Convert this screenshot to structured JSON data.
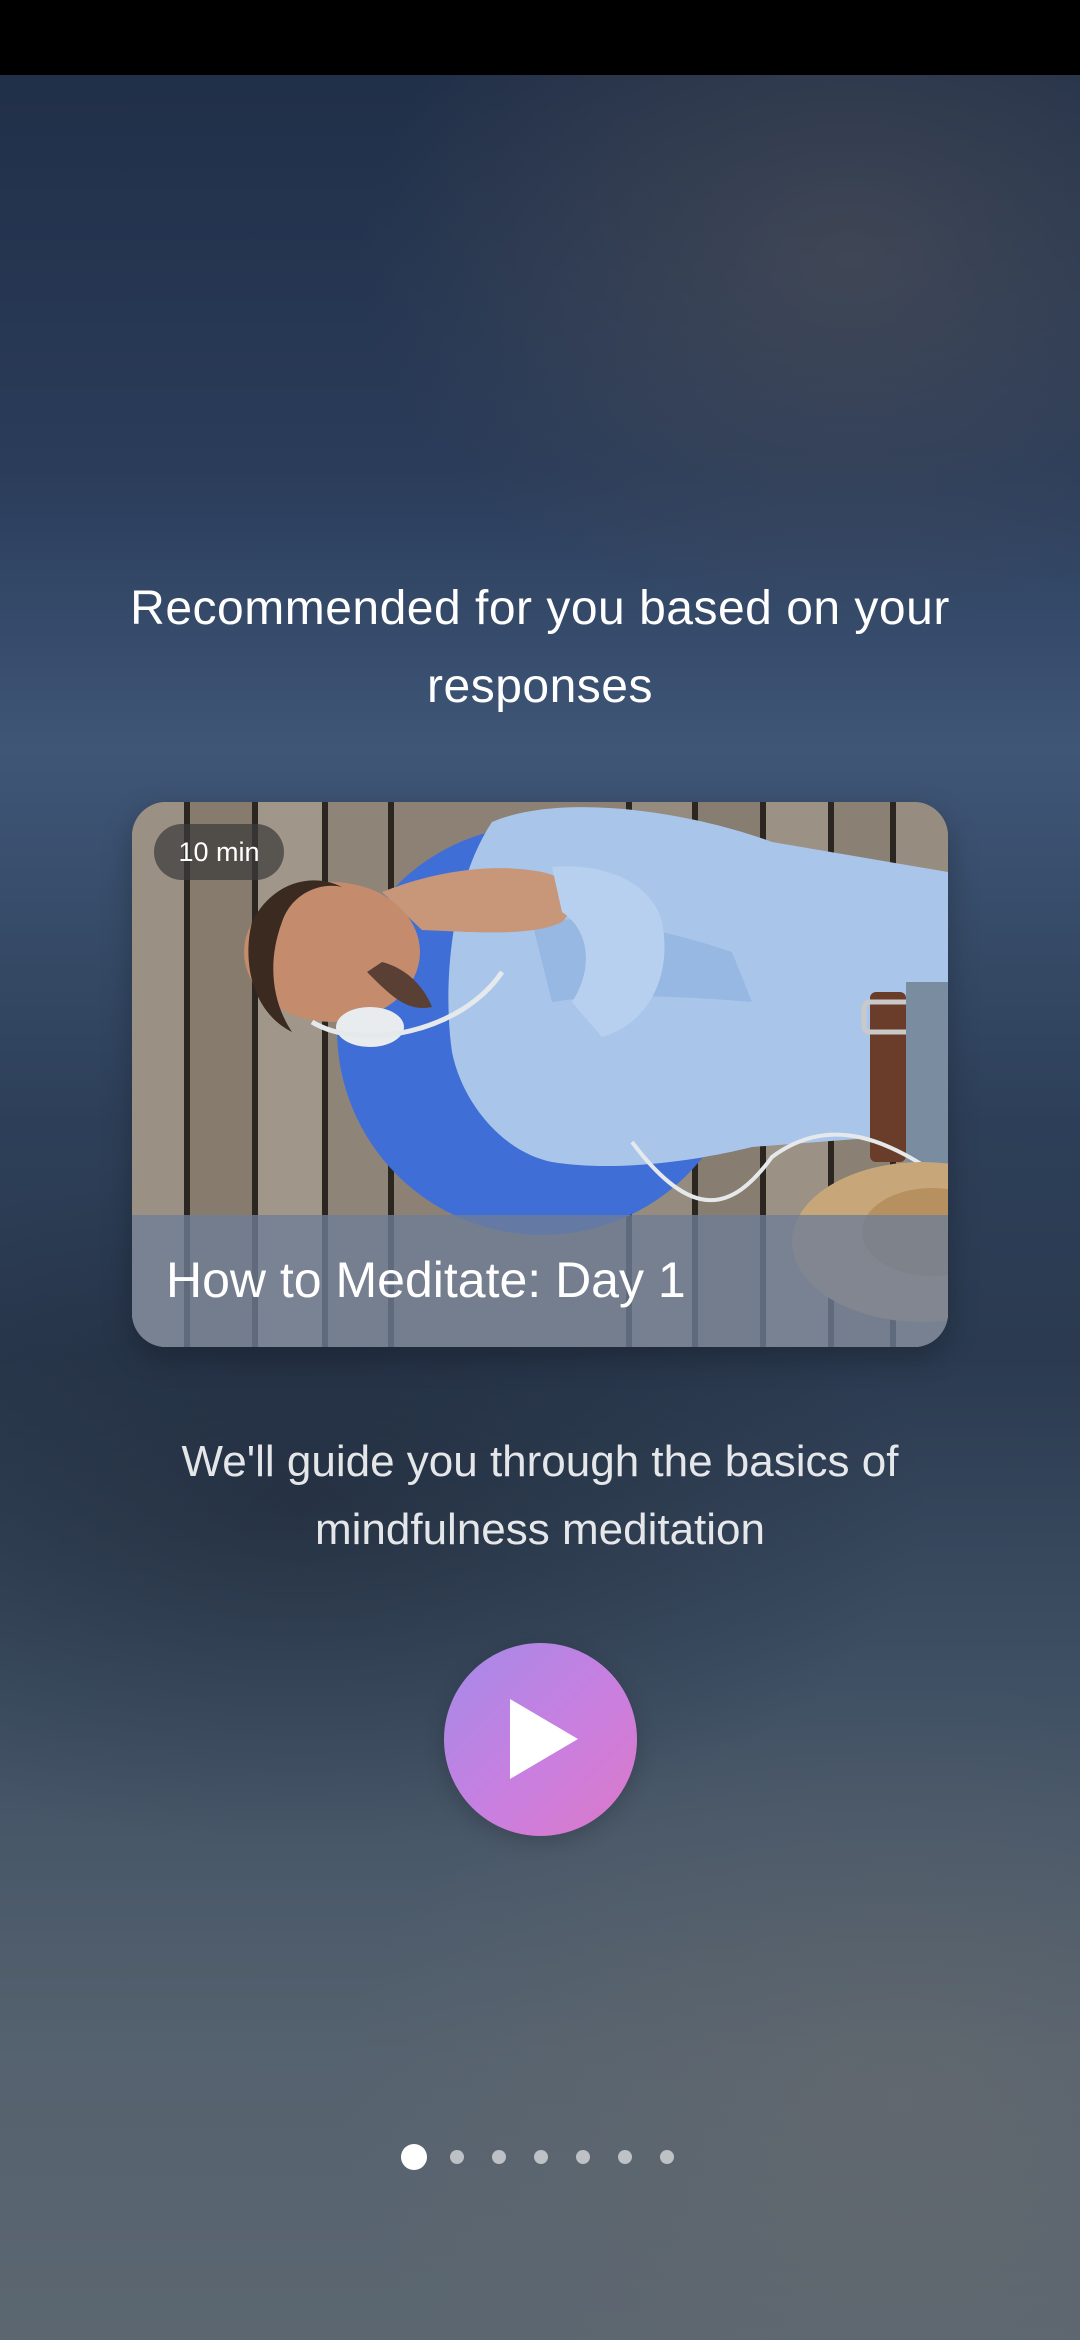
{
  "onboarding": {
    "heading": "Recommended for you based on your responses",
    "card": {
      "duration_badge": "10 min",
      "title": "How to Meditate: Day 1"
    },
    "subtitle": "We'll guide you through the basics of mindfulness meditation",
    "play_icon": "play-icon"
  },
  "pager": {
    "total_pages": 7,
    "current_page": 1
  },
  "colors": {
    "play_gradient_start": "#a48ae8",
    "play_gradient_end": "#dc78c8",
    "card_circle": "#3f6fd6"
  }
}
